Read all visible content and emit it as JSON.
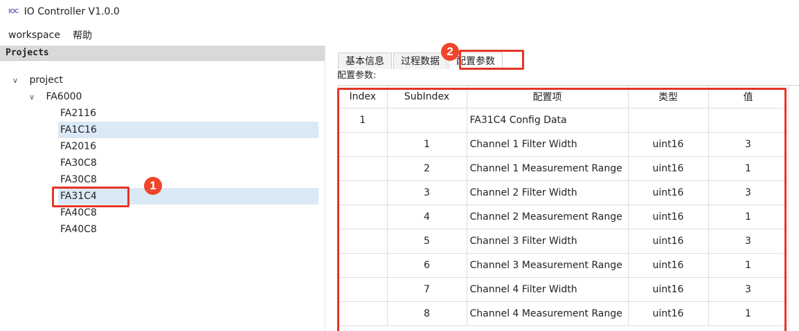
{
  "window": {
    "icon_text": "IOC",
    "title": "IO Controller V1.0.0"
  },
  "menu": {
    "items": [
      "workspace",
      "帮助"
    ]
  },
  "projects": {
    "header": "Projects",
    "root": "project",
    "device": "FA6000",
    "modules": [
      "FA2116",
      "FA1C16",
      "FA2016",
      "FA30C8",
      "FA30C8",
      "FA31C4",
      "FA40C8",
      "FA40C8"
    ],
    "selected_module": "FA31C4"
  },
  "tabs": [
    "基本信息",
    "过程数据",
    "配置参数"
  ],
  "active_tab": "配置参数",
  "config_label": "配置参数:",
  "table": {
    "headers": [
      "Index",
      "SubIndex",
      "配置项",
      "类型",
      "值"
    ],
    "rows": [
      {
        "index": "1",
        "subindex": "",
        "item": "FA31C4 Config Data",
        "type": "",
        "value": ""
      },
      {
        "index": "",
        "subindex": "1",
        "item": "Channel 1 Filter Width",
        "type": "uint16",
        "value": "3"
      },
      {
        "index": "",
        "subindex": "2",
        "item": "Channel 1 Measurement Range",
        "type": "uint16",
        "value": "1"
      },
      {
        "index": "",
        "subindex": "3",
        "item": "Channel 2 Filter Width",
        "type": "uint16",
        "value": "3"
      },
      {
        "index": "",
        "subindex": "4",
        "item": "Channel 2 Measurement Range",
        "type": "uint16",
        "value": "1"
      },
      {
        "index": "",
        "subindex": "5",
        "item": "Channel 3 Filter Width",
        "type": "uint16",
        "value": "3"
      },
      {
        "index": "",
        "subindex": "6",
        "item": "Channel 3 Measurement Range",
        "type": "uint16",
        "value": "1"
      },
      {
        "index": "",
        "subindex": "7",
        "item": "Channel 4 Filter Width",
        "type": "uint16",
        "value": "3"
      },
      {
        "index": "",
        "subindex": "8",
        "item": "Channel 4 Measurement Range",
        "type": "uint16",
        "value": "1"
      }
    ]
  },
  "annotations": {
    "badge_1": "1",
    "badge_2": "2",
    "highlight_color": "#e53525"
  }
}
